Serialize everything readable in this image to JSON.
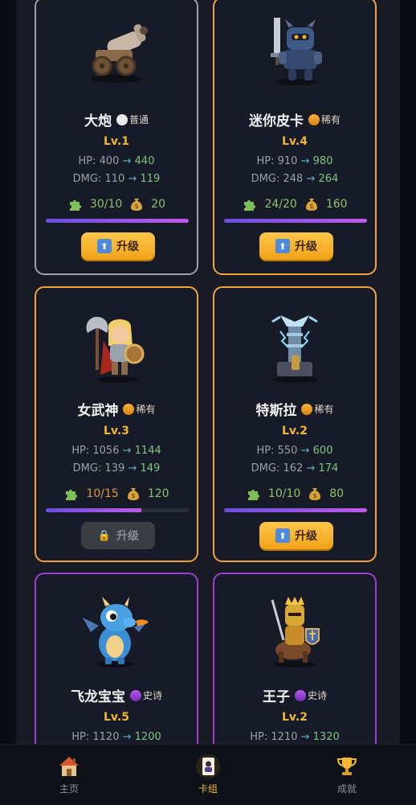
{
  "cards": [
    {
      "name": "大炮",
      "rarity": "普通",
      "rarity_class": "common",
      "level": "Lv.1",
      "hp_label": "HP:",
      "hp_from": "400",
      "hp_to": "440",
      "dmg_label": "DMG:",
      "dmg_from": "110",
      "dmg_to": "119",
      "pieces": "30/10",
      "coins": "20",
      "progress": 1.0,
      "upgrade_label": "升级",
      "upgrade_enabled": true,
      "icon": "cannon-icon"
    },
    {
      "name": "迷你皮卡",
      "rarity": "稀有",
      "rarity_class": "rare",
      "level": "Lv.4",
      "hp_label": "HP:",
      "hp_from": "910",
      "hp_to": "980",
      "dmg_label": "DMG:",
      "dmg_from": "248",
      "dmg_to": "264",
      "pieces": "24/20",
      "coins": "160",
      "progress": 1.0,
      "upgrade_label": "升级",
      "upgrade_enabled": true,
      "icon": "robot-knight-icon"
    },
    {
      "name": "女武神",
      "rarity": "稀有",
      "rarity_class": "rare",
      "level": "Lv.3",
      "hp_label": "HP:",
      "hp_from": "1056",
      "hp_to": "1144",
      "dmg_label": "DMG:",
      "dmg_from": "139",
      "dmg_to": "149",
      "pieces": "10/15",
      "coins": "120",
      "progress": 0.67,
      "upgrade_label": "升级",
      "upgrade_enabled": false,
      "icon": "valkyrie-icon"
    },
    {
      "name": "特斯拉",
      "rarity": "稀有",
      "rarity_class": "rare",
      "level": "Lv.2",
      "hp_label": "HP:",
      "hp_from": "550",
      "hp_to": "600",
      "dmg_label": "DMG:",
      "dmg_from": "162",
      "dmg_to": "174",
      "pieces": "10/10",
      "coins": "80",
      "progress": 1.0,
      "upgrade_label": "升级",
      "upgrade_enabled": true,
      "icon": "tesla-tower-icon"
    },
    {
      "name": "飞龙宝宝",
      "rarity": "史诗",
      "rarity_class": "epic",
      "level": "Lv.5",
      "hp_label": "HP:",
      "hp_from": "1120",
      "hp_to": "1200",
      "icon": "baby-dragon-icon"
    },
    {
      "name": "王子",
      "rarity": "史诗",
      "rarity_class": "epic",
      "level": "Lv.2",
      "hp_label": "HP:",
      "hp_from": "1210",
      "hp_to": "1320",
      "icon": "prince-icon"
    }
  ],
  "arrow": "→",
  "tabs": [
    {
      "label": "主页",
      "icon": "house-icon",
      "active": false
    },
    {
      "label": "卡组",
      "icon": "card-deck-icon",
      "active": true
    },
    {
      "label": "成就",
      "icon": "trophy-icon",
      "active": false
    }
  ],
  "colors": {
    "rare_border": "#f2a33a",
    "epic_border": "#9b3fd2",
    "common_border": "#9ea3a8",
    "level_text": "#f2b632",
    "upgrade_button": "#ffc64a"
  }
}
